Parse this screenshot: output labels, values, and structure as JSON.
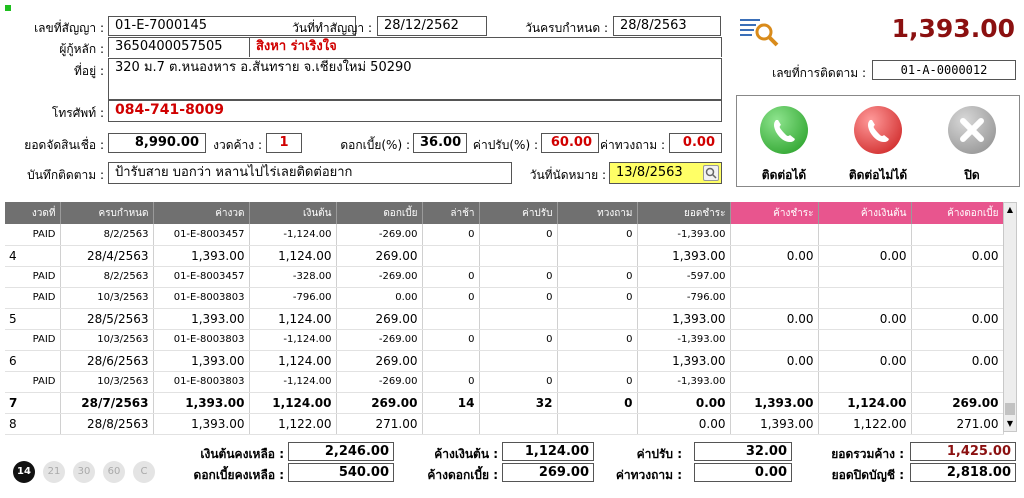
{
  "contract": {
    "no_label": "เลขที่สัญญา :",
    "no": "01-E-7000145",
    "date_label": "วันที่ทำสัญญา :",
    "date": "28/12/2562",
    "due_label": "วันครบกำหนด :",
    "due": "28/8/2563",
    "borrower_label": "ผู้กู้หลัก :",
    "borrower_id": "3650400057505",
    "borrower_name": "สิงหา ร่าเริงใจ",
    "address_label": "ที่อยู่ :",
    "address": "320 ม.7 ต.หนองหาร อ.สันทราย จ.เชียงใหม่ 50290",
    "phone_label": "โทรศัพท์ :",
    "phone": "084-741-8009",
    "total_amount": "1,393.00",
    "tracking_label": "เลขที่การติดตาม :",
    "tracking_no": "01-A-0000012"
  },
  "finance": {
    "credit_label": "ยอดจัดสินเชื่อ :",
    "credit": "8,990.00",
    "overdue_label": "งวดค้าง :",
    "overdue": "1",
    "interest_label": "ดอกเบี้ย(%) :",
    "interest": "36.00",
    "penalty_label": "ค่าปรับ(%) :",
    "penalty": "60.00",
    "collect_label": "ค่าทวงถาม :",
    "collect": "0.00",
    "note_label": "บันทึกติดตาม :",
    "note": "ป้ารับสาย บอกว่า หลานไปไร่เลยติดต่อยาก",
    "appoint_label": "วันที่นัดหมาย :",
    "appoint": "13/8/2563"
  },
  "actions": {
    "contact_ok": "ติดต่อได้",
    "contact_fail": "ติดต่อไม่ได้",
    "close": "ปิด"
  },
  "table": {
    "headers": [
      "งวดที่",
      "ครบกำหนด",
      "ค่างวด",
      "เงินต้น",
      "ดอกเบี้ย",
      "ล่าช้า",
      "ค่าปรับ",
      "ทวงถาม",
      "ยอดชำระ",
      "ค้างชำระ",
      "ค้างเงินต้น",
      "ค้างดอกเบี้ย"
    ],
    "rows": [
      {
        "t": "sub",
        "c": [
          "PAID",
          "8/2/2563",
          "01-E-8003457",
          "-1,124.00",
          "-269.00",
          "0",
          "0",
          "0",
          "-1,393.00",
          "",
          "",
          ""
        ]
      },
      {
        "t": "main",
        "c": [
          "4",
          "28/4/2563",
          "1,393.00",
          "1,124.00",
          "269.00",
          "",
          "",
          "",
          "1,393.00",
          "0.00",
          "0.00",
          "0.00"
        ]
      },
      {
        "t": "sub",
        "c": [
          "PAID",
          "8/2/2563",
          "01-E-8003457",
          "-328.00",
          "-269.00",
          "0",
          "0",
          "0",
          "-597.00",
          "",
          "",
          ""
        ]
      },
      {
        "t": "sub",
        "c": [
          "PAID",
          "10/3/2563",
          "01-E-8003803",
          "-796.00",
          "0.00",
          "0",
          "0",
          "0",
          "-796.00",
          "",
          "",
          ""
        ]
      },
      {
        "t": "main",
        "c": [
          "5",
          "28/5/2563",
          "1,393.00",
          "1,124.00",
          "269.00",
          "",
          "",
          "",
          "1,393.00",
          "0.00",
          "0.00",
          "0.00"
        ]
      },
      {
        "t": "sub",
        "c": [
          "PAID",
          "10/3/2563",
          "01-E-8003803",
          "-1,124.00",
          "-269.00",
          "0",
          "0",
          "0",
          "-1,393.00",
          "",
          "",
          ""
        ]
      },
      {
        "t": "main",
        "c": [
          "6",
          "28/6/2563",
          "1,393.00",
          "1,124.00",
          "269.00",
          "",
          "",
          "",
          "1,393.00",
          "0.00",
          "0.00",
          "0.00"
        ]
      },
      {
        "t": "sub",
        "c": [
          "PAID",
          "10/3/2563",
          "01-E-8003803",
          "-1,124.00",
          "-269.00",
          "0",
          "0",
          "0",
          "-1,393.00",
          "",
          "",
          ""
        ]
      },
      {
        "t": "boldrow",
        "c": [
          "7",
          "28/7/2563",
          "1,393.00",
          "1,124.00",
          "269.00",
          "14",
          "32",
          "0",
          "0.00",
          "1,393.00",
          "1,124.00",
          "269.00"
        ]
      },
      {
        "t": "main",
        "c": [
          "8",
          "28/8/2563",
          "1,393.00",
          "1,122.00",
          "271.00",
          "",
          "",
          "",
          "0.00",
          "1,393.00",
          "1,122.00",
          "271.00"
        ]
      }
    ]
  },
  "pages": [
    "14",
    "21",
    "30",
    "60",
    "C"
  ],
  "summary": {
    "principal_left_label": "เงินต้นคงเหลือ :",
    "principal_left": "2,246.00",
    "interest_left_label": "ดอกเบี้ยคงเหลือ :",
    "interest_left": "540.00",
    "principal_due_label": "ค้างเงินต้น :",
    "principal_due": "1,124.00",
    "interest_due_label": "ค้างดอกเบี้ย :",
    "interest_due": "269.00",
    "penalty_label": "ค่าปรับ :",
    "penalty": "32.00",
    "collect_label": "ค่าทวงถาม :",
    "collect": "0.00",
    "total_due_label": "ยอดรวมค้าง :",
    "total_due": "1,425.00",
    "close_label": "ยอดปิดบัญชี :",
    "close": "2,818.00"
  },
  "colors": {
    "header": "#707070",
    "pink": "#e8558e",
    "red": "#d00000",
    "amount": "#8b1010",
    "appoint_bg": "#ffff66"
  }
}
